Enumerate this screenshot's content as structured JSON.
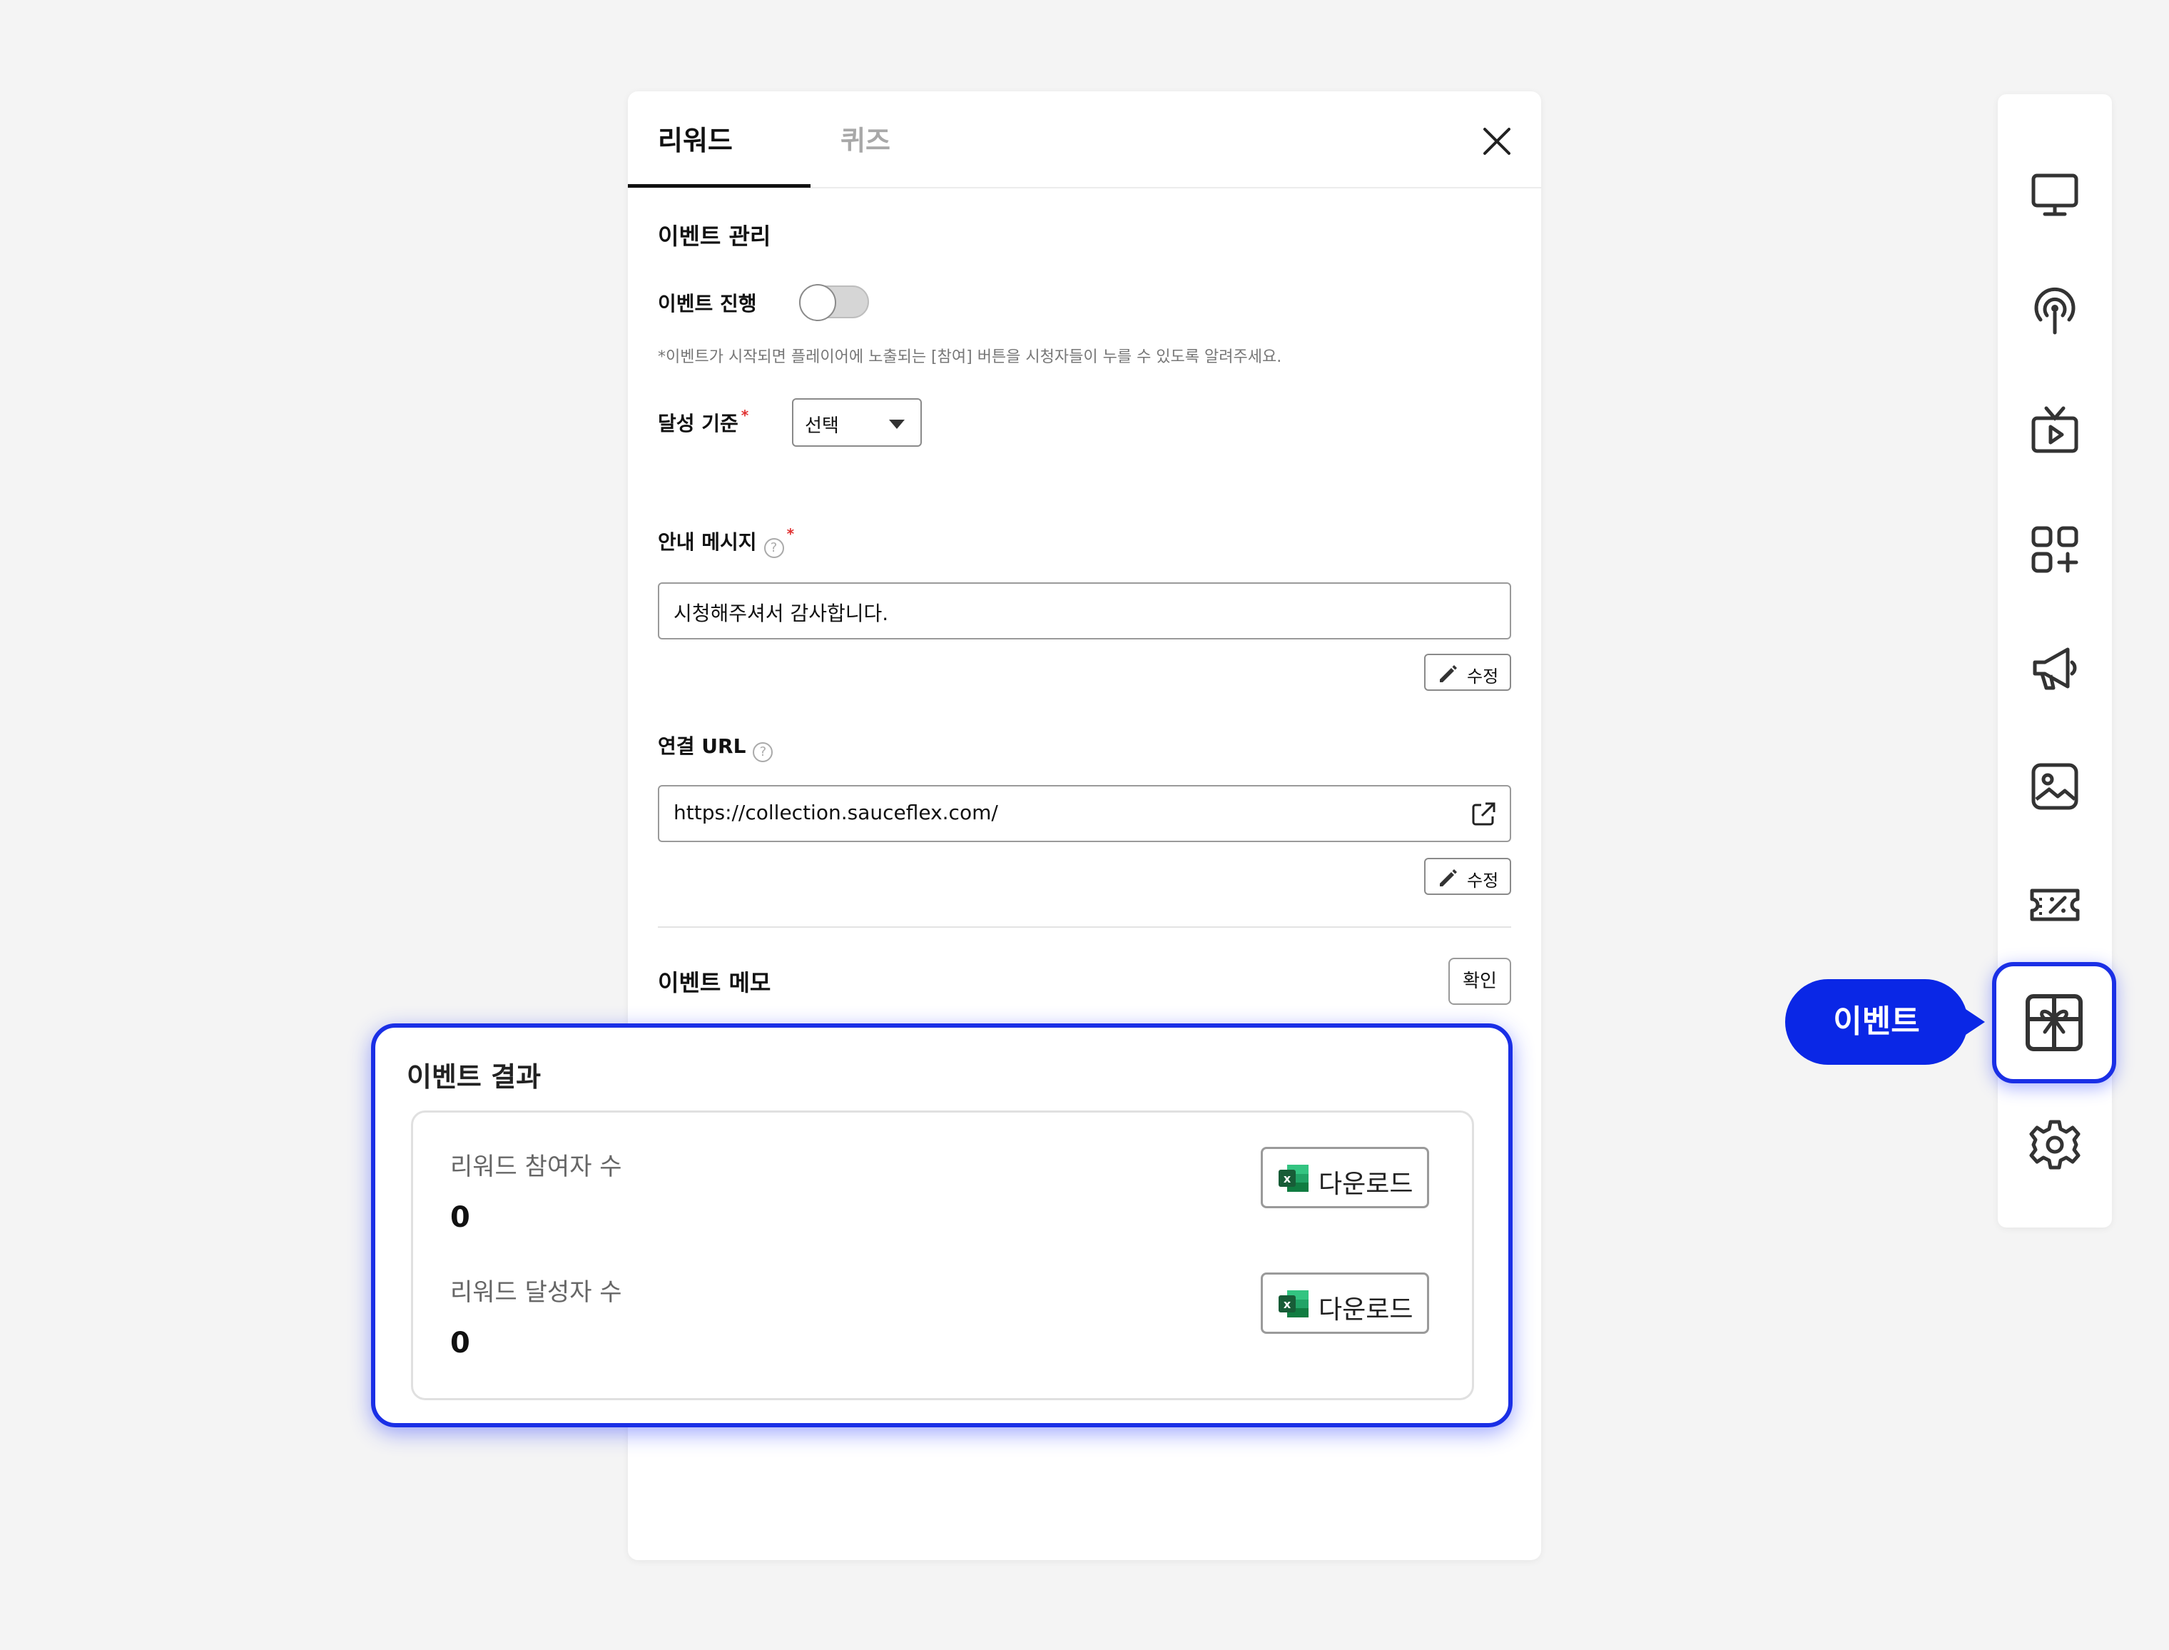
{
  "tabs": [
    {
      "label": "리워드",
      "active": true
    },
    {
      "label": "퀴즈",
      "active": false
    }
  ],
  "event_management": {
    "title": "이벤트 관리",
    "progress_label": "이벤트 진행",
    "progress_on": false,
    "hint": "*이벤트가 시작되면 플레이어에 노출되는 [참여] 버튼을 시청자들이 누를 수 있도록 알려주세요.",
    "criteria_label": "달성 기준",
    "criteria_required": "*",
    "criteria_value": "선택",
    "message_label": "안내 메시지",
    "message_required": "*",
    "message_value": "시청해주셔서 감사합니다.",
    "edit_label": "수정",
    "url_label": "연결 URL",
    "url_value": "https://collection.sauceflex.com/",
    "memo_label": "이벤트 메모",
    "confirm_label": "확인",
    "help_glyph": "?"
  },
  "event_result": {
    "title": "이벤트 결과",
    "participants_label": "리워드 참여자 수",
    "participants_value": "0",
    "achievers_label": "리워드 달성자 수",
    "achievers_value": "0",
    "download_label": "다운로드"
  },
  "sidebar": {
    "items": [
      "monitor-icon",
      "broadcast-icon",
      "tv-play-icon",
      "apps-add-icon",
      "megaphone-icon",
      "image-icon",
      "coupon-icon",
      "gift-icon",
      "settings-icon"
    ],
    "active": "gift-icon",
    "tooltip": "이벤트"
  },
  "colors": {
    "accent": "#1a2fe6",
    "tooltip": "#0a27e6",
    "excel": "#1d7a45"
  }
}
